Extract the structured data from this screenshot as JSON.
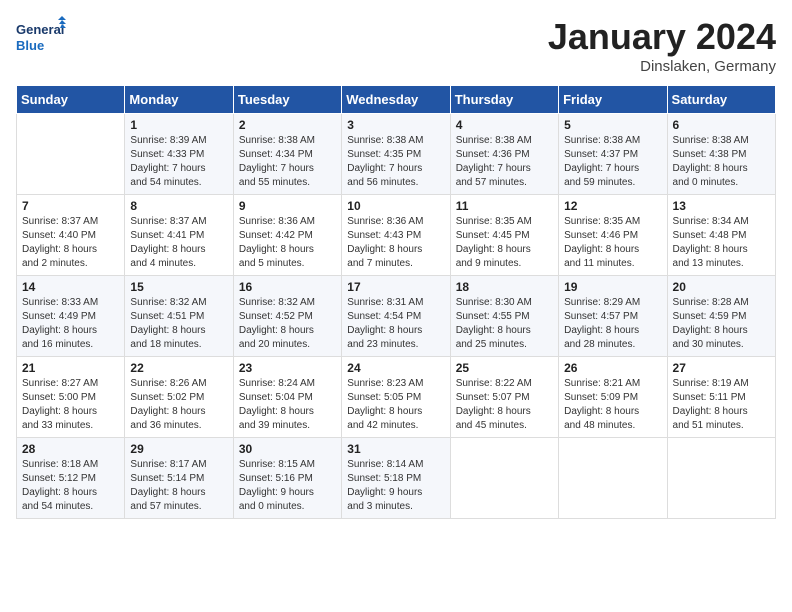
{
  "logo": {
    "line1": "General",
    "line2": "Blue"
  },
  "title": "January 2024",
  "subtitle": "Dinslaken, Germany",
  "days_of_week": [
    "Sunday",
    "Monday",
    "Tuesday",
    "Wednesday",
    "Thursday",
    "Friday",
    "Saturday"
  ],
  "weeks": [
    [
      {
        "day": "",
        "info": ""
      },
      {
        "day": "1",
        "info": "Sunrise: 8:39 AM\nSunset: 4:33 PM\nDaylight: 7 hours\nand 54 minutes."
      },
      {
        "day": "2",
        "info": "Sunrise: 8:38 AM\nSunset: 4:34 PM\nDaylight: 7 hours\nand 55 minutes."
      },
      {
        "day": "3",
        "info": "Sunrise: 8:38 AM\nSunset: 4:35 PM\nDaylight: 7 hours\nand 56 minutes."
      },
      {
        "day": "4",
        "info": "Sunrise: 8:38 AM\nSunset: 4:36 PM\nDaylight: 7 hours\nand 57 minutes."
      },
      {
        "day": "5",
        "info": "Sunrise: 8:38 AM\nSunset: 4:37 PM\nDaylight: 7 hours\nand 59 minutes."
      },
      {
        "day": "6",
        "info": "Sunrise: 8:38 AM\nSunset: 4:38 PM\nDaylight: 8 hours\nand 0 minutes."
      }
    ],
    [
      {
        "day": "7",
        "info": "Sunrise: 8:37 AM\nSunset: 4:40 PM\nDaylight: 8 hours\nand 2 minutes."
      },
      {
        "day": "8",
        "info": "Sunrise: 8:37 AM\nSunset: 4:41 PM\nDaylight: 8 hours\nand 4 minutes."
      },
      {
        "day": "9",
        "info": "Sunrise: 8:36 AM\nSunset: 4:42 PM\nDaylight: 8 hours\nand 5 minutes."
      },
      {
        "day": "10",
        "info": "Sunrise: 8:36 AM\nSunset: 4:43 PM\nDaylight: 8 hours\nand 7 minutes."
      },
      {
        "day": "11",
        "info": "Sunrise: 8:35 AM\nSunset: 4:45 PM\nDaylight: 8 hours\nand 9 minutes."
      },
      {
        "day": "12",
        "info": "Sunrise: 8:35 AM\nSunset: 4:46 PM\nDaylight: 8 hours\nand 11 minutes."
      },
      {
        "day": "13",
        "info": "Sunrise: 8:34 AM\nSunset: 4:48 PM\nDaylight: 8 hours\nand 13 minutes."
      }
    ],
    [
      {
        "day": "14",
        "info": "Sunrise: 8:33 AM\nSunset: 4:49 PM\nDaylight: 8 hours\nand 16 minutes."
      },
      {
        "day": "15",
        "info": "Sunrise: 8:32 AM\nSunset: 4:51 PM\nDaylight: 8 hours\nand 18 minutes."
      },
      {
        "day": "16",
        "info": "Sunrise: 8:32 AM\nSunset: 4:52 PM\nDaylight: 8 hours\nand 20 minutes."
      },
      {
        "day": "17",
        "info": "Sunrise: 8:31 AM\nSunset: 4:54 PM\nDaylight: 8 hours\nand 23 minutes."
      },
      {
        "day": "18",
        "info": "Sunrise: 8:30 AM\nSunset: 4:55 PM\nDaylight: 8 hours\nand 25 minutes."
      },
      {
        "day": "19",
        "info": "Sunrise: 8:29 AM\nSunset: 4:57 PM\nDaylight: 8 hours\nand 28 minutes."
      },
      {
        "day": "20",
        "info": "Sunrise: 8:28 AM\nSunset: 4:59 PM\nDaylight: 8 hours\nand 30 minutes."
      }
    ],
    [
      {
        "day": "21",
        "info": "Sunrise: 8:27 AM\nSunset: 5:00 PM\nDaylight: 8 hours\nand 33 minutes."
      },
      {
        "day": "22",
        "info": "Sunrise: 8:26 AM\nSunset: 5:02 PM\nDaylight: 8 hours\nand 36 minutes."
      },
      {
        "day": "23",
        "info": "Sunrise: 8:24 AM\nSunset: 5:04 PM\nDaylight: 8 hours\nand 39 minutes."
      },
      {
        "day": "24",
        "info": "Sunrise: 8:23 AM\nSunset: 5:05 PM\nDaylight: 8 hours\nand 42 minutes."
      },
      {
        "day": "25",
        "info": "Sunrise: 8:22 AM\nSunset: 5:07 PM\nDaylight: 8 hours\nand 45 minutes."
      },
      {
        "day": "26",
        "info": "Sunrise: 8:21 AM\nSunset: 5:09 PM\nDaylight: 8 hours\nand 48 minutes."
      },
      {
        "day": "27",
        "info": "Sunrise: 8:19 AM\nSunset: 5:11 PM\nDaylight: 8 hours\nand 51 minutes."
      }
    ],
    [
      {
        "day": "28",
        "info": "Sunrise: 8:18 AM\nSunset: 5:12 PM\nDaylight: 8 hours\nand 54 minutes."
      },
      {
        "day": "29",
        "info": "Sunrise: 8:17 AM\nSunset: 5:14 PM\nDaylight: 8 hours\nand 57 minutes."
      },
      {
        "day": "30",
        "info": "Sunrise: 8:15 AM\nSunset: 5:16 PM\nDaylight: 9 hours\nand 0 minutes."
      },
      {
        "day": "31",
        "info": "Sunrise: 8:14 AM\nSunset: 5:18 PM\nDaylight: 9 hours\nand 3 minutes."
      },
      {
        "day": "",
        "info": ""
      },
      {
        "day": "",
        "info": ""
      },
      {
        "day": "",
        "info": ""
      }
    ]
  ]
}
